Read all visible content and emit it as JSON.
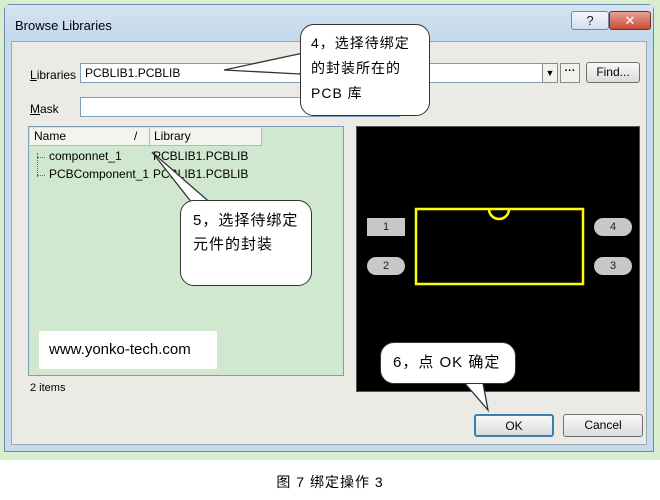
{
  "window": {
    "title": "Browse Libraries",
    "help_label": "?",
    "close_label": "✕"
  },
  "form": {
    "libraries_label_u": "L",
    "libraries_label_rest": "ibraries",
    "libraries_value": "PCBLIB1.PCBLIB",
    "find_label": "Find...",
    "mask_label_u": "M",
    "mask_label_rest": "ask",
    "mask_value": ""
  },
  "list": {
    "columns": [
      "Name",
      "Library"
    ],
    "sort_indicator": "/",
    "rows": [
      {
        "name": "componnet_1",
        "library": "PCBLIB1.PCBLIB"
      },
      {
        "name": "PCBComponent_1",
        "library": "PCBLIB1.PCBLIB"
      }
    ],
    "count_text": "2 items"
  },
  "watermark": "www.yonko-tech.com",
  "preview": {
    "pads": [
      "1",
      "2",
      "3",
      "4"
    ],
    "outline_color": "#ffff00",
    "background": "#000000"
  },
  "buttons": {
    "ok": "OK",
    "cancel": "Cancel"
  },
  "callouts": {
    "c4": "4，选择待绑定的封装所在的 PCB 库",
    "c5": "5，选择待绑定元件的封装",
    "c6": "6，点 OK 确定"
  },
  "caption": "图 7 绑定操作 3"
}
